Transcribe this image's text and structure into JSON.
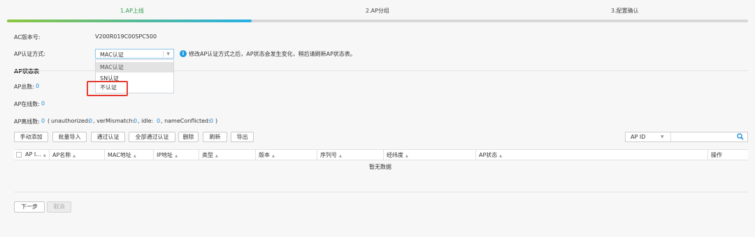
{
  "steps": [
    {
      "label": "1.AP上线"
    },
    {
      "label": "2.AP分组"
    },
    {
      "label": "3.配置确认"
    }
  ],
  "progress_fraction": 0.33,
  "form": {
    "ac_version_label": "AC版本号:",
    "ac_version_value": "V200R019C00SPC500",
    "auth_mode_label": "AP认证方式:",
    "auth_mode_selected": "MAC认证",
    "auth_mode_options": [
      "MAC认证",
      "SN认证",
      "不认证"
    ],
    "info_text": "修改AP认证方式之后，AP状态会发生变化，稍后请刷新AP状态表。"
  },
  "status": {
    "title": "AP状态表",
    "total_label": "AP总数:",
    "total_value": "0",
    "online_label": "AP在线数:",
    "online_value": "0",
    "offline_label": "AP离线数:",
    "offline_value": "0",
    "offline_detail_open": "(",
    "unauthorized_label": "unauthorized:",
    "unauthorized_value": "0",
    "verMismatch_label": ", verMismatch:",
    "verMismatch_value": "0",
    "idle_label": ", idle:",
    "idle_value": "0",
    "nameConflicted_label": ", nameConflicted:",
    "nameConflicted_value": "0",
    "offline_detail_close": ")"
  },
  "toolbar": {
    "add_manual": "手动添加",
    "batch_import": "批量导入",
    "approve": "通过认证",
    "approve_all": "全部通过认证",
    "delete": "删除",
    "refresh": "刷新",
    "export": "导出",
    "search_category": "AP ID",
    "search_value": ""
  },
  "table": {
    "headers": [
      "AP I...",
      "AP名称",
      "MAC地址",
      "IP地址",
      "类型",
      "版本",
      "序列号",
      "经纬度",
      "AP状态",
      "操作"
    ],
    "empty_text": "暂无数据"
  },
  "footer": {
    "next": "下一步",
    "cancel": "取消"
  },
  "colors": {
    "accent_green": "#2e9f4f",
    "link_blue": "#1f8fd6",
    "highlight_red": "#e53b2e"
  }
}
